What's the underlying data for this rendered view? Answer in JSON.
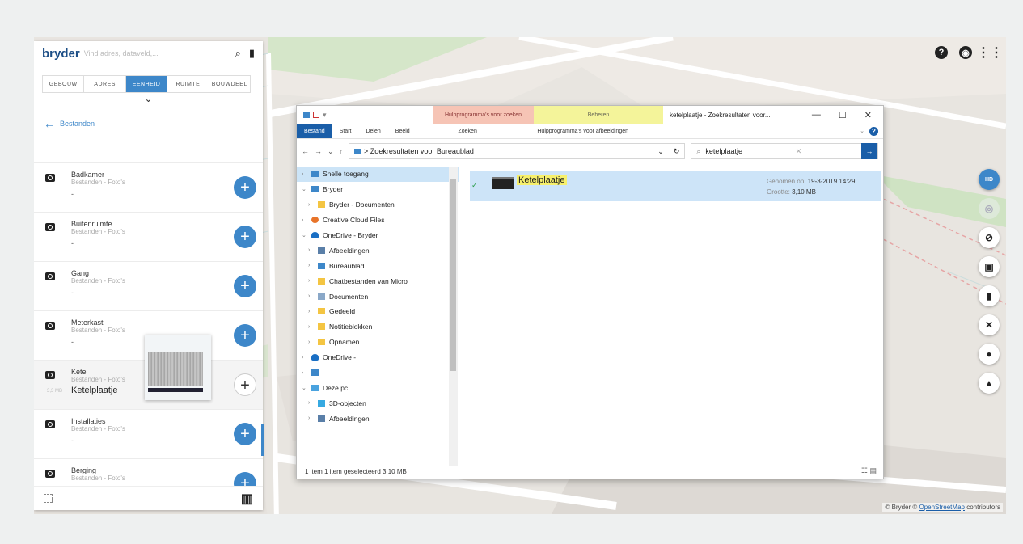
{
  "brand": "bryder",
  "search": {
    "placeholder": "Vind adres, dataveld,..."
  },
  "tabs": [
    {
      "label": "GEBOUW",
      "active": false
    },
    {
      "label": "ADRES",
      "active": false
    },
    {
      "label": "EENHEID",
      "active": true
    },
    {
      "label": "RUIMTE",
      "active": false
    },
    {
      "label": "BOUWDEEL",
      "active": false
    }
  ],
  "back_label": "Bestanden",
  "items": [
    {
      "title": "Badkamer",
      "sub": "Bestanden - Foto's",
      "detail": "-"
    },
    {
      "title": "Buitenruimte",
      "sub": "Bestanden - Foto's",
      "detail": "-"
    },
    {
      "title": "Gang",
      "sub": "Bestanden - Foto's",
      "detail": "-"
    },
    {
      "title": "Meterkast",
      "sub": "Bestanden - Foto's",
      "detail": "-"
    },
    {
      "title": "Ketel",
      "sub": "Bestanden - Foto's",
      "size": "3,3 MB",
      "file": "Ketelplaatje"
    },
    {
      "title": "Installaties",
      "sub": "Bestanden - Foto's",
      "detail": "-"
    },
    {
      "title": "Berging",
      "sub": "Bestanden - Foto's",
      "detail": ""
    }
  ],
  "explorer": {
    "title": "ketelplaatje - Zoekresultaten voor...",
    "ctx_search_tools": "Hulpprogramma's voor zoeken",
    "ctx_manage": "Beheren",
    "ribbon_tabs": [
      "Bestand",
      "Start",
      "Delen",
      "Beeld"
    ],
    "ribbon_search": "Zoeken",
    "ribbon_image_tools": "Hulpprogramma's voor afbeeldingen",
    "address": "Zoekresultaten voor Bureaublad",
    "search_value": "ketelplaatje",
    "nav": [
      {
        "label": "Snelle toegang",
        "indent": 0,
        "selected": true
      },
      {
        "label": "Bryder",
        "indent": 0
      },
      {
        "label": "Bryder - Documenten",
        "indent": 1
      },
      {
        "label": "Creative Cloud Files",
        "indent": 0
      },
      {
        "label": "OneDrive - Bryder",
        "indent": 0
      },
      {
        "label": "Afbeeldingen",
        "indent": 1
      },
      {
        "label": "Bureaublad",
        "indent": 1
      },
      {
        "label": "Chatbestanden van Micro",
        "indent": 1
      },
      {
        "label": "Documenten",
        "indent": 1
      },
      {
        "label": "Gedeeld",
        "indent": 1
      },
      {
        "label": "Notitieblokken",
        "indent": 1
      },
      {
        "label": "Opnamen",
        "indent": 1
      },
      {
        "label": "OneDrive -",
        "indent": 0
      },
      {
        "label": "",
        "indent": 0
      },
      {
        "label": "Deze pc",
        "indent": 0
      },
      {
        "label": "3D-objecten",
        "indent": 1
      },
      {
        "label": "Afbeeldingen",
        "indent": 1
      }
    ],
    "result_name": "Ketelplaatje",
    "taken_label": "Genomen op:",
    "taken_value": "19-3-2019 14:29",
    "size_label": "Grootte:",
    "size_value": "3,10 MB",
    "status": "1 item    1 item geselecteerd  3,10 MB"
  },
  "attribution_prefix": "© Bryder © ",
  "attribution_link": "OpenStreetMap",
  "attribution_suffix": " contributors"
}
